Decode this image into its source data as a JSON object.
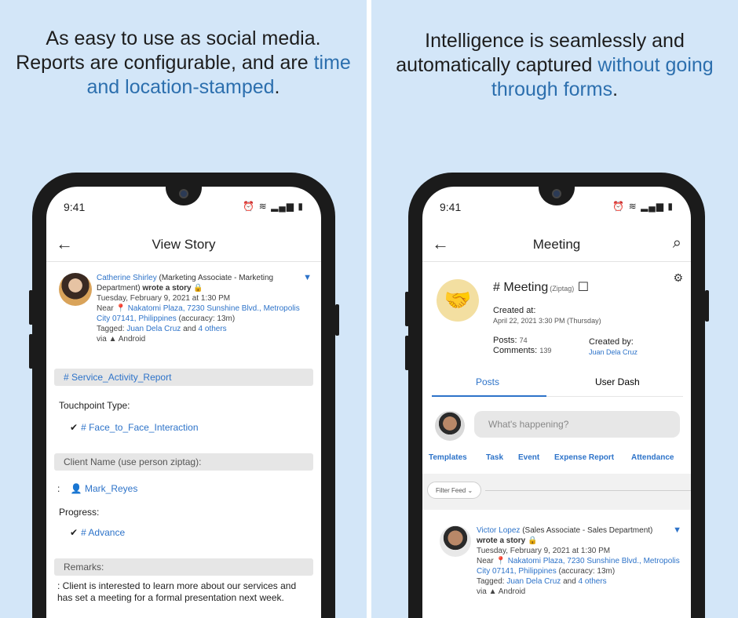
{
  "left": {
    "headline_line1": "As easy to use as social media.",
    "headline_line2_prefix": "Reports are configurable, and are ",
    "headline_highlight": "time and location-stamped",
    "headline_suffix": ".",
    "status": {
      "time": "9:41"
    },
    "appbar": {
      "title": "View Story"
    },
    "post": {
      "author": "Catherine Shirley",
      "role": "(Marketing Associate - Marketing Department)",
      "action": "wrote a story",
      "timestamp": "Tuesday, February 9, 2021 at 1:30 PM",
      "near_prefix": "Near",
      "location": "Nakatomi Plaza, 7230 Sunshine Blvd., Metropolis City 07141, Philippines",
      "accuracy": "(accuracy: 13m)",
      "tagged_prefix": "Tagged:",
      "tagged_person": "Juan Dela Cruz",
      "tagged_and": "and",
      "tagged_others": "4 others",
      "via_prefix": "via",
      "via_platform": "Android"
    },
    "report_tag": "Service_Activity_Report",
    "touchpoint_label": "Touchpoint Type:",
    "touchpoint_value": "Face_to_Face_Interaction",
    "client_label": "Client Name (use person ziptag):",
    "client_value": "Mark_Reyes",
    "progress_label": "Progress:",
    "progress_value": "Advance",
    "remarks_label": "Remarks:",
    "remarks_text": ": Client is interested to learn more about our services and has set a meeting for a formal presentation next week."
  },
  "right": {
    "headline_line1": "Intelligence is seamlessly and",
    "headline_line2_prefix": "automatically captured ",
    "headline_highlight": "without going through forms",
    "headline_suffix": ".",
    "status": {
      "time": "9:41"
    },
    "appbar": {
      "title": "Meeting"
    },
    "meeting": {
      "title": "Meeting",
      "ziptag": "(Ziptag)",
      "created_at_label": "Created at:",
      "created_at_value": "April 22, 2021 3:30 PM (Thursday)",
      "posts_label": "Posts:",
      "posts_value": "74",
      "comments_label": "Comments:",
      "comments_value": "139",
      "created_by_label": "Created by:",
      "created_by_value": "Juan Dela Cruz"
    },
    "tabs": [
      "Posts",
      "User Dash"
    ],
    "compose_placeholder": "What's happening?",
    "actions": [
      "Templates",
      "Task",
      "Event",
      "Expense Report",
      "Attendance"
    ],
    "filter_label": "Filter Feed",
    "post": {
      "author": "Victor Lopez",
      "role": "(Sales Associate - Sales Department)",
      "action": "wrote a story",
      "timestamp": "Tuesday, February 9, 2021 at 1:30 PM",
      "near_prefix": "Near",
      "location": "Nakatomi Plaza, 7230 Sunshine Blvd., Metropolis City 07141, Philippines",
      "accuracy": "(accuracy: 13m)",
      "tagged_prefix": "Tagged:",
      "tagged_person": "Juan Dela Cruz",
      "tagged_and": "and",
      "tagged_others": "4 others",
      "via_prefix": "via",
      "via_platform": "Android"
    }
  }
}
